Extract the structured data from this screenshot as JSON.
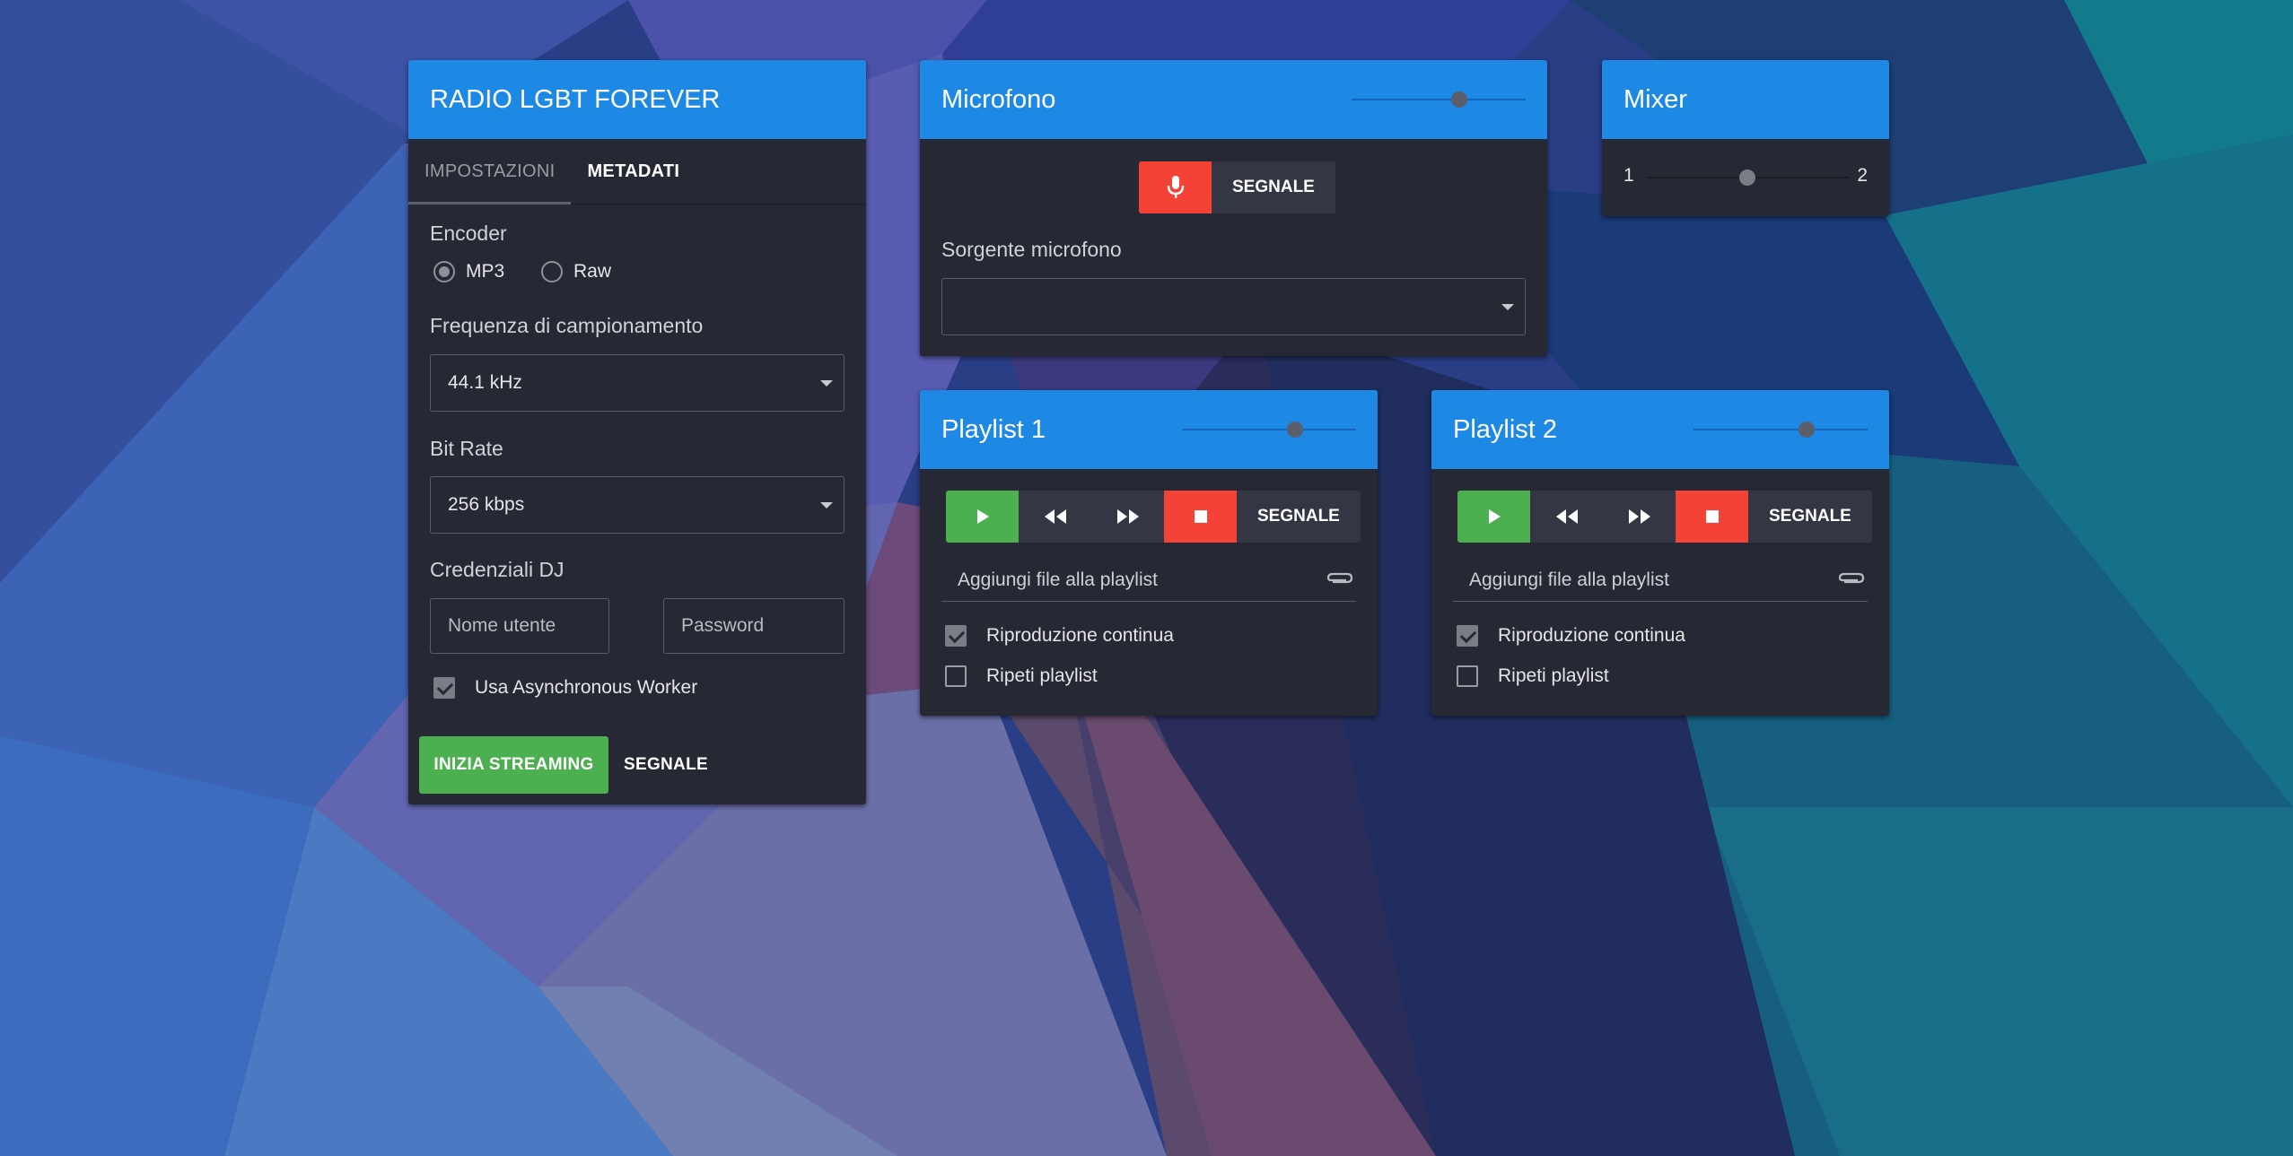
{
  "colors": {
    "header": "#1e88e5",
    "panel": "#262833",
    "green": "#4caf50",
    "red": "#f44336"
  },
  "stream_panel": {
    "title": "RADIO LGBT FOREVER",
    "tabs": [
      {
        "label": "IMPOSTAZIONI",
        "selected": true
      },
      {
        "label": "METADATI",
        "selected": false
      }
    ],
    "encoder": {
      "label": "Encoder",
      "options": [
        {
          "label": "MP3",
          "checked": true
        },
        {
          "label": "Raw",
          "checked": false
        }
      ]
    },
    "sample_rate": {
      "label": "Frequenza di campionamento",
      "value": "44.1 kHz"
    },
    "bit_rate": {
      "label": "Bit Rate",
      "value": "256 kbps"
    },
    "credentials": {
      "label": "Credenziali DJ",
      "username_placeholder": "Nome utente",
      "password_placeholder": "Password"
    },
    "async_worker": {
      "label": "Usa Asynchronous Worker",
      "checked": true
    },
    "start_button": "INIZIA STREAMING",
    "signal_button": "SEGNALE"
  },
  "microphone_panel": {
    "title": "Microfono",
    "volume": 0.62,
    "mic_icon": "microphone-icon",
    "signal_button": "SEGNALE",
    "source_label": "Sorgente microfono",
    "source_value": ""
  },
  "mixer_panel": {
    "title": "Mixer",
    "left_label": "1",
    "right_label": "2",
    "position": 0.5
  },
  "playlists": [
    {
      "title": "Playlist 1",
      "volume": 0.65,
      "signal_button": "SEGNALE",
      "add_files_placeholder": "Aggiungi file alla playlist",
      "continuous": {
        "label": "Riproduzione continua",
        "checked": true
      },
      "repeat": {
        "label": "Ripeti playlist",
        "checked": false
      }
    },
    {
      "title": "Playlist 2",
      "volume": 0.65,
      "signal_button": "SEGNALE",
      "add_files_placeholder": "Aggiungi file alla playlist",
      "continuous": {
        "label": "Riproduzione continua",
        "checked": true
      },
      "repeat": {
        "label": "Ripeti playlist",
        "checked": false
      }
    }
  ]
}
